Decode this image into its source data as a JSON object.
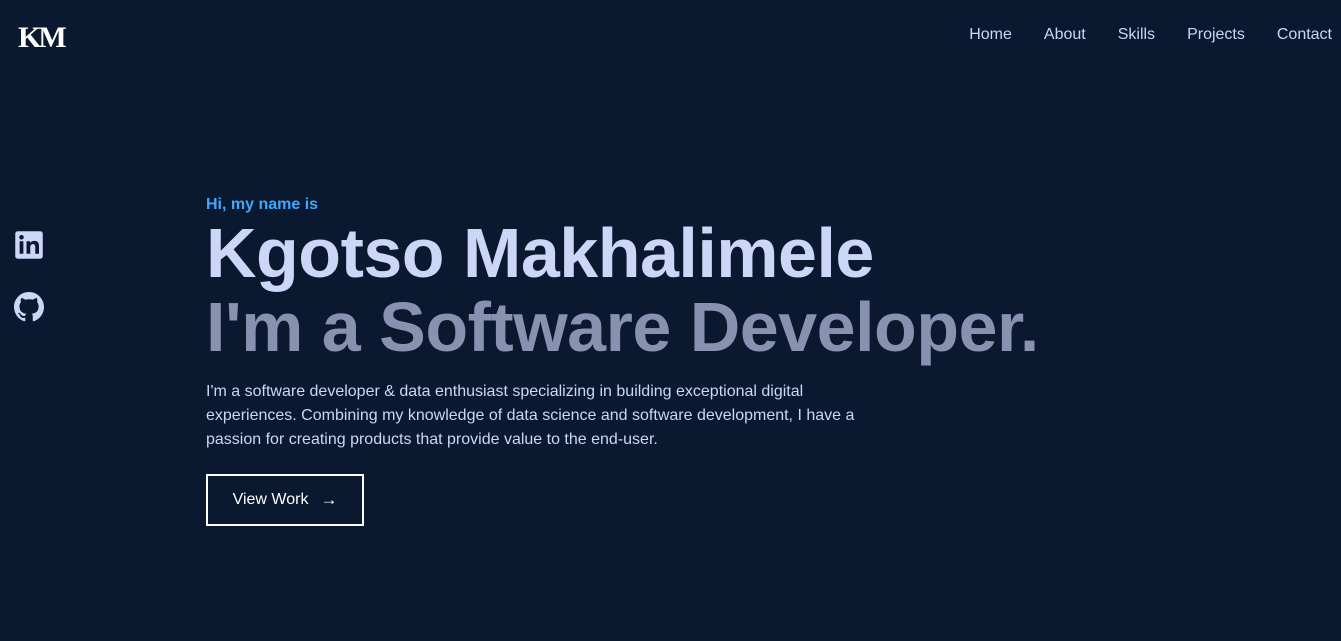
{
  "header": {
    "logo": "KM",
    "nav": [
      "Home",
      "About",
      "Skills",
      "Projects",
      "Contact"
    ]
  },
  "socials": [
    {
      "icon": "linkedin-icon"
    },
    {
      "icon": "github-icon"
    }
  ],
  "hero": {
    "greeting": "Hi, my name is",
    "name": "Kgotso Makhalimele",
    "role": "I'm a Software Developer.",
    "intro": "I'm a software developer & data enthusiast specializing in building exceptional digital experiences. Combining my knowledge of data science and software development, I have a passion for creating products that provide value to the end-user.",
    "cta_label": "View Work",
    "cta_arrow": "→"
  },
  "colors": {
    "background": "#0a192f",
    "accent": "#3ea8ff",
    "heading": "#ccd6f6",
    "subheading": "#8892b0",
    "text": "#ccd6f6"
  }
}
